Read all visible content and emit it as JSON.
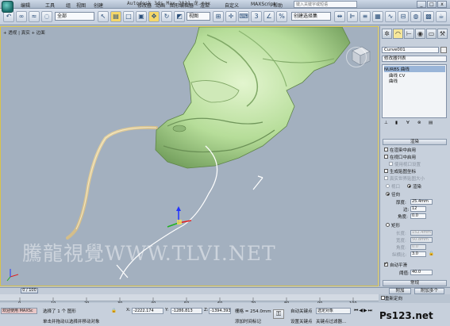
{
  "title_bar": {
    "title": "Autodesk 3ds Max  2011    龙.max",
    "menus": [
      "编辑",
      "工具",
      "组",
      "视图",
      "创建",
      "修改器",
      "动画",
      "图形编辑器",
      "渲染",
      "自定义",
      "MAXScript",
      "帮助"
    ],
    "search_placeholder": "键入关键字或短语",
    "buttons": [
      "_",
      "□",
      "x"
    ]
  },
  "toolbar": {
    "selection_filter": "全部",
    "ref_coord": "视图",
    "named_selection": "创建选择集"
  },
  "viewport": {
    "label": "+ 透视 | 真实 + 边面",
    "watermark": "騰龍視覺WWW.TLVI.NET"
  },
  "command_panel": {
    "object_name": "Curve001",
    "modifier_list": "修改器列表",
    "stack": [
      "NURBS 曲线",
      "曲线 CV",
      "曲线"
    ],
    "rollout_render": "渲染",
    "checks": {
      "enable_render": "在渲染中启用",
      "enable_viewport": "在视口中启用",
      "use_viewport_settings": "使用视口设置",
      "gen_map_coords": "生成贴图坐标",
      "real_world_map": "真实世界贴图大小",
      "auto_smooth": "自动平滑"
    },
    "viewport_label": "视口",
    "render_label": "渲染",
    "radial_label": "径向",
    "rectangular_label": "矩形",
    "thickness_label": "厚度:",
    "thickness_value": "25.4mm",
    "sides_label": "边:",
    "sides_value": "12",
    "angle_label": "角度:",
    "angle_value": "0.0",
    "length_label": "长度:",
    "length_value": "152.4mm",
    "width_label": "宽度:",
    "width_value": "50.8mm",
    "angle2_label": "角度:",
    "angle2_value": "0.0",
    "aspect_label": "纵横比:",
    "aspect_value": "3.0",
    "threshold_label": "阈值:",
    "threshold_value": "40.0",
    "rollout_general": "常规",
    "attach_button": "附加",
    "attach_multiple_button": "附加多个",
    "reorient_label": "重新定向"
  },
  "time_slider": {
    "position": "0 / 100",
    "ticks": [
      "0",
      "10",
      "20",
      "30",
      "40",
      "50",
      "60",
      "70",
      "80",
      "90",
      "100"
    ]
  },
  "status_bar": {
    "maxscript_label": "欢迎使用 MAXSc",
    "selected": "选择了 1 个 图形",
    "prompt": "单击并拖动以选择并移动对象",
    "x_label": "X:",
    "x_value": "-2222.174",
    "y_label": "Y:",
    "y_value": "-1286.813",
    "z_label": "Z:",
    "z_value": "-1394.393",
    "grid": "栅格 = 254.0mm",
    "add_time_tag": "添加时间标记",
    "auto_key": "自动关键点",
    "selected_obj": "选定对象",
    "set_key": "设置关键点",
    "key_filters": "关键点过滤器...",
    "brand": "Ps123.net"
  }
}
